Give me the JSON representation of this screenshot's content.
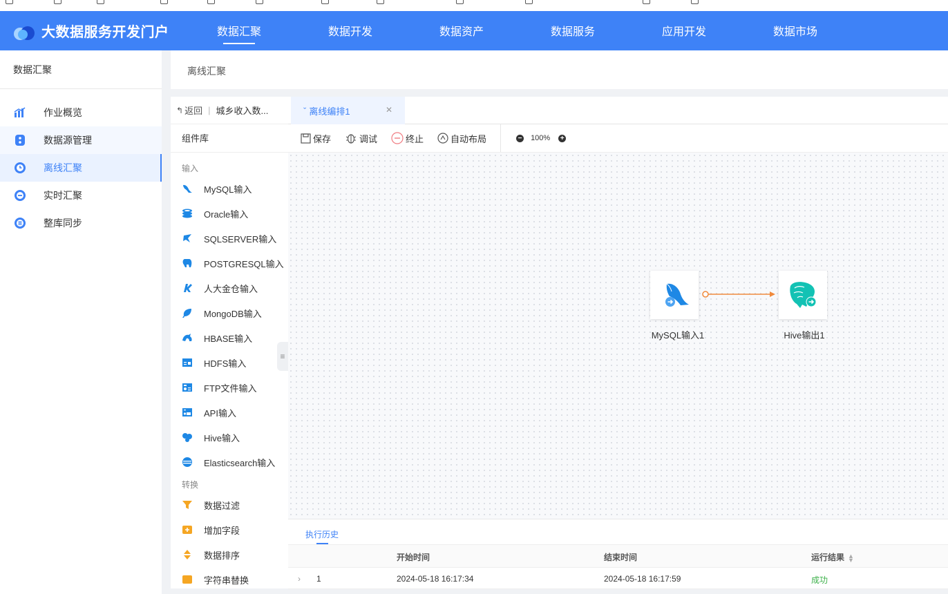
{
  "header": {
    "title": "大数据服务开发门户",
    "nav": [
      {
        "label": "数据汇聚",
        "active": true
      },
      {
        "label": "数据开发"
      },
      {
        "label": "数据资产"
      },
      {
        "label": "数据服务"
      },
      {
        "label": "应用开发"
      },
      {
        "label": "数据市场"
      }
    ],
    "accent_color": "#3e82f7"
  },
  "sidebar": {
    "title": "数据汇聚",
    "items": [
      {
        "label": "作业概览",
        "icon": "chart-bar-icon"
      },
      {
        "label": "数据源管理",
        "icon": "database-icon"
      },
      {
        "label": "离线汇聚",
        "icon": "clock-icon",
        "active": true
      },
      {
        "label": "实时汇聚",
        "icon": "realtime-icon"
      },
      {
        "label": "整库同步",
        "icon": "sync-icon"
      }
    ]
  },
  "breadcrumb": "离线汇聚",
  "workspace": {
    "back_label": "返回",
    "project_name": "城乡收入数...",
    "library_title": "组件库",
    "groups": [
      {
        "title": "输入",
        "items": [
          "MySQL输入",
          "Oracle输入",
          "SQLSERVER输入",
          "POSTGRESQL输入",
          "人大金仓输入",
          "MongoDB输入",
          "HBASE输入",
          "HDFS输入",
          "FTP文件输入",
          "API输入",
          "Hive输入",
          "Elasticsearch输入"
        ]
      },
      {
        "title": "转换",
        "items": [
          "数据过滤",
          "增加字段",
          "数据排序",
          "字符串替换"
        ]
      }
    ]
  },
  "tab": {
    "label": "离线编排1"
  },
  "toolbar": {
    "save": "保存",
    "debug": "调试",
    "stop": "终止",
    "auto_layout": "自动布局",
    "zoom": "100%"
  },
  "canvas": {
    "nodes": [
      {
        "label": "MySQL输入1",
        "icon": "mysql-dolphin-icon"
      },
      {
        "label": "Hive输出1",
        "icon": "hive-bee-icon"
      }
    ]
  },
  "history": {
    "tab_label": "执行历史",
    "columns": [
      "开始时间",
      "结束时间",
      "运行结果"
    ],
    "rows": [
      {
        "index": "1",
        "start": "2024-05-18 16:17:34",
        "end": "2024-05-18 16:17:59",
        "result": "成功"
      }
    ]
  }
}
